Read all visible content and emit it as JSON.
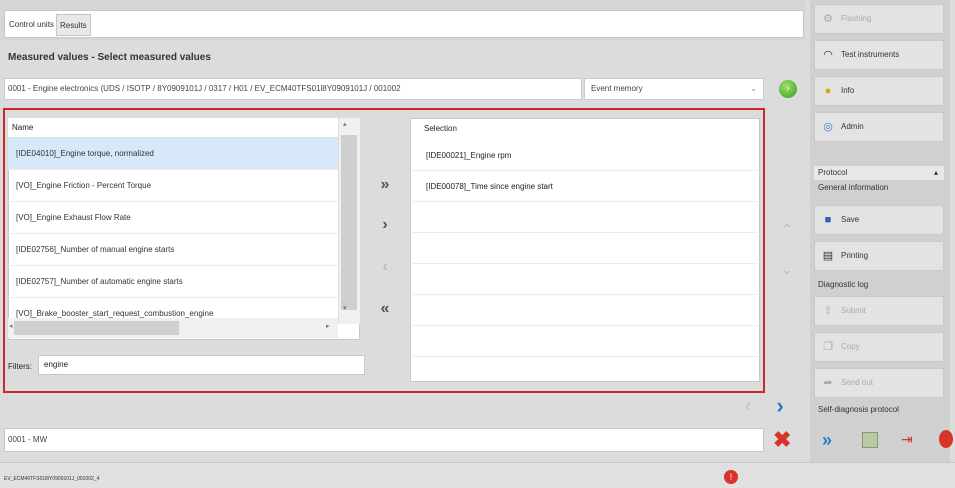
{
  "tabs": [
    {
      "label": "Control units"
    },
    {
      "label": "Results"
    }
  ],
  "page_title": "Measured values - Select measured values",
  "path": "0001 - Engine electronics  (UDS / ISOTP / 8Y0909101J / 0317 / H01 / EV_ECM40TFS01l8Y0909101J / 001002",
  "event_select": "Event memory",
  "name_header": "Name",
  "name_list": [
    "[IDE04010]_Engine torque, normalized",
    "[VO]_Engine Friction - Percent Torque",
    "[VO]_Engine Exhaust Flow Rate",
    "[IDE02756]_Number of manual engine starts",
    "[IDE02757]_Number of automatic engine starts",
    "[VO]_Brake_booster_start_request_combustion_engine"
  ],
  "filter_label": "Filters:",
  "filter_value": "engine",
  "selection_header": "Selection",
  "selection_list": [
    "[IDE00021]_Engine rpm",
    "[IDE00078]_Time since engine start"
  ],
  "right_panel": {
    "flashing": "Flashing",
    "test_instruments": "Test instruments",
    "info": "Info",
    "admin": "Admin",
    "protocol": "Protocol",
    "general_information": "General information",
    "save": "Save",
    "printing": "Printing",
    "diagnostic_log": "Diagnostic log",
    "submit": "Submit",
    "copy": "Copy",
    "send_out": "Send out",
    "self_diagnosis": "Self-diagnosis protocol"
  },
  "bottom_field": "0001 - MW",
  "status_text": "EV_ECM40TFS01l8Y0909101J_001002_4",
  "colors": {
    "accent_red": "#cc2a2a",
    "selected_row": "#d7e9f9",
    "link_blue": "#2a78c8"
  }
}
